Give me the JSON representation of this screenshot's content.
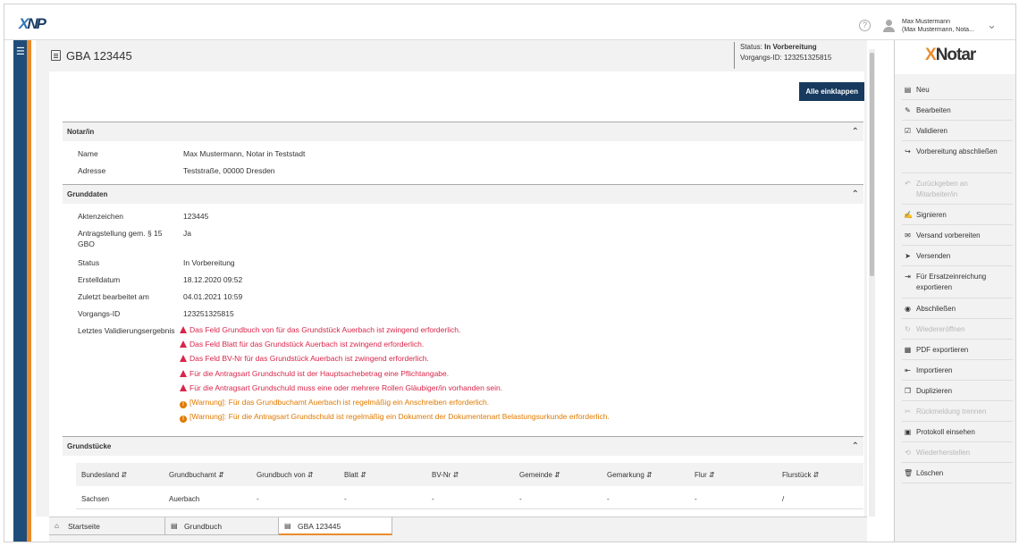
{
  "app": {
    "user_name": "Max Mustermann",
    "user_sub": "(Max Mustermann, Nota..."
  },
  "header": {
    "title": "GBA 123445",
    "status_label": "Status:",
    "status_value": "In Vorbereitung",
    "vorgang_label": "Vorgangs-ID:",
    "vorgang_value": "123251325815"
  },
  "collapse_all": "Alle einklappen",
  "notar": {
    "heading": "Notar/in",
    "rows": [
      {
        "k": "Name",
        "v": "Max Mustermann, Notar in Teststadt"
      },
      {
        "k": "Adresse",
        "v": "Teststraße, 00000 Dresden"
      }
    ]
  },
  "grunddaten": {
    "heading": "Grunddaten",
    "rows": [
      {
        "k": "Aktenzeichen",
        "v": "123445"
      },
      {
        "k": "Antragstellung gem. § 15 GBO",
        "v": "Ja"
      },
      {
        "k": "Status",
        "v": "In Vorbereitung"
      },
      {
        "k": "Erstelldatum",
        "v": "18.12.2020 09:52"
      },
      {
        "k": "Zuletzt bearbeitet am",
        "v": "04.01.2021 10:59"
      },
      {
        "k": "Vorgangs-ID",
        "v": "123251325815"
      }
    ],
    "validation_label": "Letztes Validierungsergebnis",
    "errors": [
      "Das Feld Grundbuch von für das Grundstück Auerbach ist zwingend erforderlich.",
      "Das Feld Blatt für das Grundstück Auerbach ist zwingend erforderlich.",
      "Das Feld BV-Nr für das Grundstück Auerbach ist zwingend erforderlich.",
      "Für die Antragsart Grundschuld ist der Hauptsachebetrag eine Pflichtangabe.",
      "Für die Antragsart Grundschuld muss eine oder mehrere Rollen Gläubiger/in vorhanden sein."
    ],
    "warnings": [
      "[Warnung]: Für das Grundbuchamt Auerbach ist regelmäßig ein Anschreiben erforderlich.",
      "[Warnung]: Für die Antragsart Grundschuld ist regelmäßig ein Dokument der Dokumentenart Belastungsurkunde erforderlich."
    ]
  },
  "grundstuecke": {
    "heading": "Grundstücke",
    "columns": [
      "Bundesland",
      "Grundbuchamt",
      "Grundbuch von",
      "Blatt",
      "BV-Nr",
      "Gemeinde",
      "Gemarkung",
      "Flur",
      "Flurstück"
    ],
    "rows": [
      [
        "Sachsen",
        "Auerbach",
        "-",
        "-",
        "-",
        "-",
        "-",
        "-",
        "/"
      ]
    ]
  },
  "actions": [
    {
      "label": "Neu",
      "icon": "doc-icon",
      "enabled": true
    },
    {
      "label": "Bearbeiten",
      "icon": "pencil-icon",
      "enabled": true
    },
    {
      "label": "Validieren",
      "icon": "check-icon",
      "enabled": true
    },
    {
      "label": "Vorbereitung abschließen",
      "icon": "share-icon",
      "enabled": true
    },
    {
      "label": "Zurückgeben an Mitarbeiter/in",
      "icon": "undo-icon",
      "enabled": false
    },
    {
      "label": "Signieren",
      "icon": "sign-icon",
      "enabled": true
    },
    {
      "label": "Versand vorbereiten",
      "icon": "envelope-icon",
      "enabled": true
    },
    {
      "label": "Versenden",
      "icon": "send-icon",
      "enabled": true
    },
    {
      "label": "Für Ersatzeinreichung exportieren",
      "icon": "export-icon",
      "enabled": true
    },
    {
      "label": "Abschließen",
      "icon": "circle-icon",
      "enabled": true
    },
    {
      "label": "Wiedereröffnen",
      "icon": "reopen-icon",
      "enabled": false
    },
    {
      "label": "PDF exportieren",
      "icon": "pdf-icon",
      "enabled": true
    },
    {
      "label": "Importieren",
      "icon": "import-icon",
      "enabled": true
    },
    {
      "label": "Duplizieren",
      "icon": "copy-icon",
      "enabled": true
    },
    {
      "label": "Rückmeldung trennen",
      "icon": "unlink-icon",
      "enabled": false
    },
    {
      "label": "Protokoll einsehen",
      "icon": "log-icon",
      "enabled": true
    },
    {
      "label": "Wiederherstellen",
      "icon": "restore-icon",
      "enabled": false
    },
    {
      "label": "Löschen",
      "icon": "trash-icon",
      "enabled": true
    }
  ],
  "tabs": [
    {
      "label": "Startseite",
      "icon": "home-icon"
    },
    {
      "label": "Grundbuch",
      "icon": "doc-icon"
    },
    {
      "label": "GBA 123445",
      "icon": "doc-icon"
    }
  ],
  "colors": {
    "nav": "#1f4d79",
    "accent": "#e98c2d",
    "error": "#d9254a",
    "warning": "#e07a00"
  }
}
